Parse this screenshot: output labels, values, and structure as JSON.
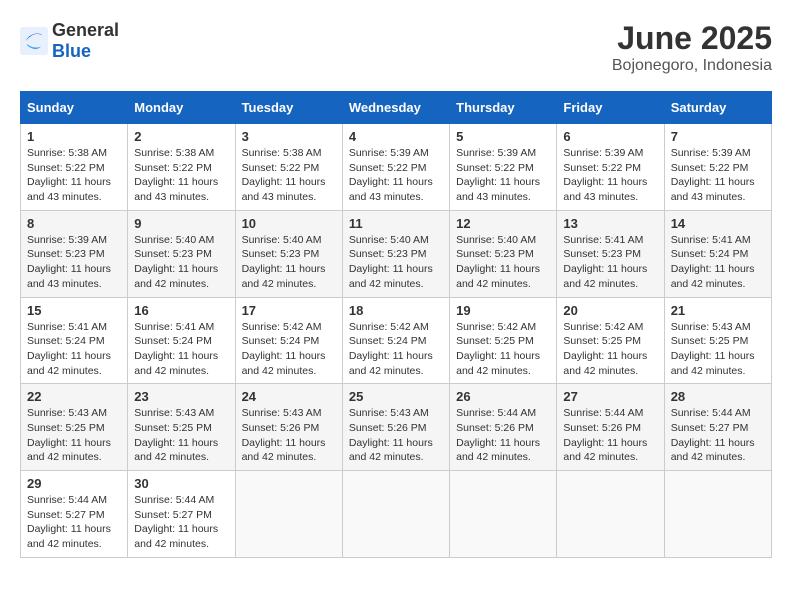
{
  "logo": {
    "general": "General",
    "blue": "Blue"
  },
  "title": "June 2025",
  "subtitle": "Bojonegoro, Indonesia",
  "weekdays": [
    "Sunday",
    "Monday",
    "Tuesday",
    "Wednesday",
    "Thursday",
    "Friday",
    "Saturday"
  ],
  "weeks": [
    [
      {
        "day": "1",
        "sunrise": "5:38 AM",
        "sunset": "5:22 PM",
        "daylight": "11 hours and 43 minutes."
      },
      {
        "day": "2",
        "sunrise": "5:38 AM",
        "sunset": "5:22 PM",
        "daylight": "11 hours and 43 minutes."
      },
      {
        "day": "3",
        "sunrise": "5:38 AM",
        "sunset": "5:22 PM",
        "daylight": "11 hours and 43 minutes."
      },
      {
        "day": "4",
        "sunrise": "5:39 AM",
        "sunset": "5:22 PM",
        "daylight": "11 hours and 43 minutes."
      },
      {
        "day": "5",
        "sunrise": "5:39 AM",
        "sunset": "5:22 PM",
        "daylight": "11 hours and 43 minutes."
      },
      {
        "day": "6",
        "sunrise": "5:39 AM",
        "sunset": "5:22 PM",
        "daylight": "11 hours and 43 minutes."
      },
      {
        "day": "7",
        "sunrise": "5:39 AM",
        "sunset": "5:22 PM",
        "daylight": "11 hours and 43 minutes."
      }
    ],
    [
      {
        "day": "8",
        "sunrise": "5:39 AM",
        "sunset": "5:23 PM",
        "daylight": "11 hours and 43 minutes."
      },
      {
        "day": "9",
        "sunrise": "5:40 AM",
        "sunset": "5:23 PM",
        "daylight": "11 hours and 42 minutes."
      },
      {
        "day": "10",
        "sunrise": "5:40 AM",
        "sunset": "5:23 PM",
        "daylight": "11 hours and 42 minutes."
      },
      {
        "day": "11",
        "sunrise": "5:40 AM",
        "sunset": "5:23 PM",
        "daylight": "11 hours and 42 minutes."
      },
      {
        "day": "12",
        "sunrise": "5:40 AM",
        "sunset": "5:23 PM",
        "daylight": "11 hours and 42 minutes."
      },
      {
        "day": "13",
        "sunrise": "5:41 AM",
        "sunset": "5:23 PM",
        "daylight": "11 hours and 42 minutes."
      },
      {
        "day": "14",
        "sunrise": "5:41 AM",
        "sunset": "5:24 PM",
        "daylight": "11 hours and 42 minutes."
      }
    ],
    [
      {
        "day": "15",
        "sunrise": "5:41 AM",
        "sunset": "5:24 PM",
        "daylight": "11 hours and 42 minutes."
      },
      {
        "day": "16",
        "sunrise": "5:41 AM",
        "sunset": "5:24 PM",
        "daylight": "11 hours and 42 minutes."
      },
      {
        "day": "17",
        "sunrise": "5:42 AM",
        "sunset": "5:24 PM",
        "daylight": "11 hours and 42 minutes."
      },
      {
        "day": "18",
        "sunrise": "5:42 AM",
        "sunset": "5:24 PM",
        "daylight": "11 hours and 42 minutes."
      },
      {
        "day": "19",
        "sunrise": "5:42 AM",
        "sunset": "5:25 PM",
        "daylight": "11 hours and 42 minutes."
      },
      {
        "day": "20",
        "sunrise": "5:42 AM",
        "sunset": "5:25 PM",
        "daylight": "11 hours and 42 minutes."
      },
      {
        "day": "21",
        "sunrise": "5:43 AM",
        "sunset": "5:25 PM",
        "daylight": "11 hours and 42 minutes."
      }
    ],
    [
      {
        "day": "22",
        "sunrise": "5:43 AM",
        "sunset": "5:25 PM",
        "daylight": "11 hours and 42 minutes."
      },
      {
        "day": "23",
        "sunrise": "5:43 AM",
        "sunset": "5:25 PM",
        "daylight": "11 hours and 42 minutes."
      },
      {
        "day": "24",
        "sunrise": "5:43 AM",
        "sunset": "5:26 PM",
        "daylight": "11 hours and 42 minutes."
      },
      {
        "day": "25",
        "sunrise": "5:43 AM",
        "sunset": "5:26 PM",
        "daylight": "11 hours and 42 minutes."
      },
      {
        "day": "26",
        "sunrise": "5:44 AM",
        "sunset": "5:26 PM",
        "daylight": "11 hours and 42 minutes."
      },
      {
        "day": "27",
        "sunrise": "5:44 AM",
        "sunset": "5:26 PM",
        "daylight": "11 hours and 42 minutes."
      },
      {
        "day": "28",
        "sunrise": "5:44 AM",
        "sunset": "5:27 PM",
        "daylight": "11 hours and 42 minutes."
      }
    ],
    [
      {
        "day": "29",
        "sunrise": "5:44 AM",
        "sunset": "5:27 PM",
        "daylight": "11 hours and 42 minutes."
      },
      {
        "day": "30",
        "sunrise": "5:44 AM",
        "sunset": "5:27 PM",
        "daylight": "11 hours and 42 minutes."
      },
      null,
      null,
      null,
      null,
      null
    ]
  ]
}
